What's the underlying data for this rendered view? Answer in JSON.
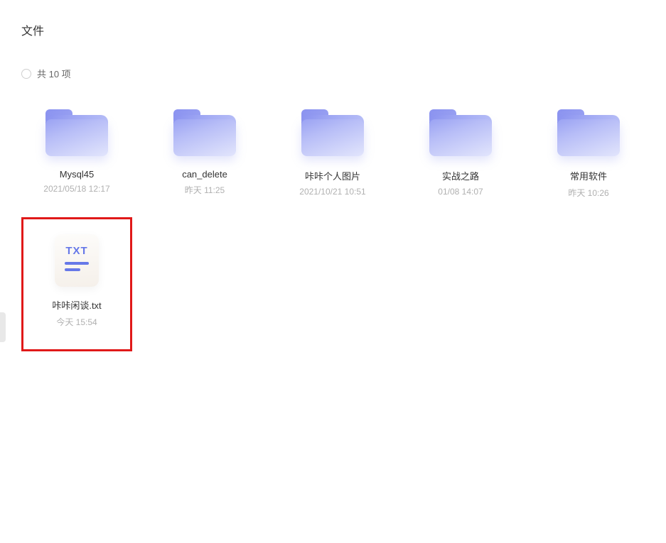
{
  "header": {
    "title": "文件"
  },
  "count_text": "共 10 项",
  "items": [
    {
      "name": "Mysql45",
      "date": "2021/05/18 12:17",
      "type": "folder",
      "highlighted": false
    },
    {
      "name": "can_delete",
      "date": "昨天 11:25",
      "type": "folder",
      "highlighted": false
    },
    {
      "name": "咔咔个人图片",
      "date": "2021/10/21 10:51",
      "type": "folder",
      "highlighted": false
    },
    {
      "name": "实战之路",
      "date": "01/08 14:07",
      "type": "folder",
      "highlighted": false
    },
    {
      "name": "常用软件",
      "date": "昨天 10:26",
      "type": "folder",
      "highlighted": false
    },
    {
      "name": "咔咔闲谈.txt",
      "date": "今天 15:54",
      "type": "txt",
      "highlighted": true
    }
  ],
  "txt_icon_label": "TXT"
}
